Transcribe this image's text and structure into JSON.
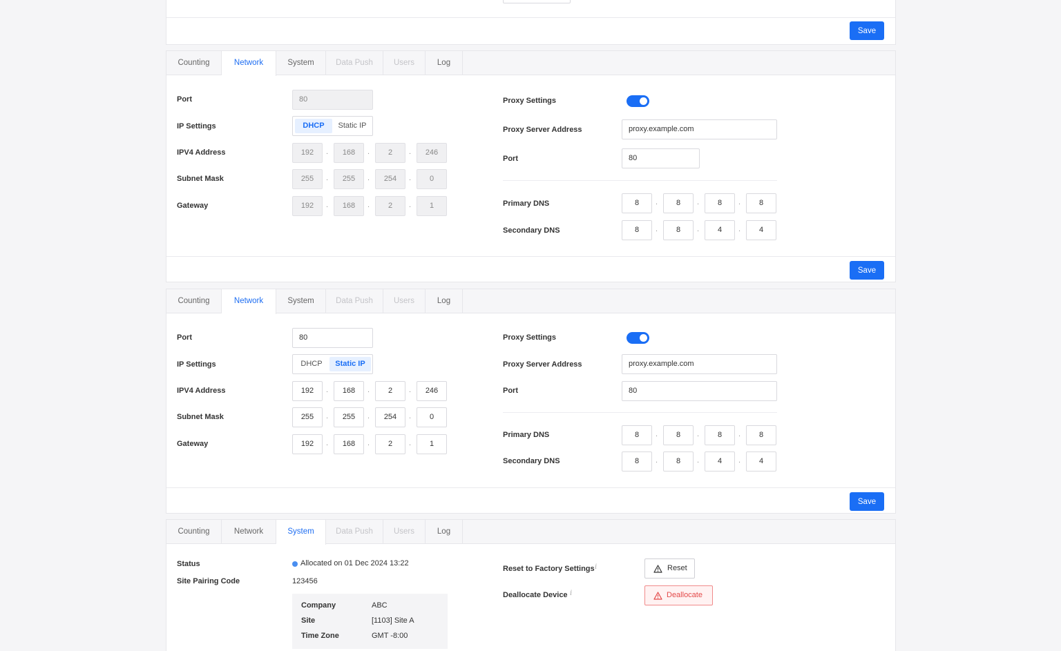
{
  "top": {
    "save_label": "Save"
  },
  "tabs": [
    {
      "label": "Counting"
    },
    {
      "label": "Network"
    },
    {
      "label": "System"
    },
    {
      "label": "Data Push"
    },
    {
      "label": "Users"
    },
    {
      "label": "Log"
    }
  ],
  "panel1": {
    "active_tab": "Network",
    "port_label": "Port",
    "port_value": "80",
    "ip_settings_label": "IP Settings",
    "ip_mode_options": [
      "DHCP",
      "Static IP"
    ],
    "ip_mode_selected": "DHCP",
    "ipv4_label": "IPV4 Address",
    "ipv4": [
      "192",
      "168",
      "2",
      "246"
    ],
    "subnet_label": "Subnet Mask",
    "subnet": [
      "255",
      "255",
      "254",
      "0"
    ],
    "gateway_label": "Gateway",
    "gateway": [
      "192",
      "168",
      "2",
      "1"
    ],
    "proxy_settings_label": "Proxy Settings",
    "proxy_enabled": true,
    "proxy_server_label": "Proxy Server Address",
    "proxy_server_value": "proxy.example.com",
    "proxy_port_label": "Port",
    "proxy_port_value": "80",
    "primary_dns_label": "Primary DNS",
    "primary_dns": [
      "8",
      "8",
      "8",
      "8"
    ],
    "secondary_dns_label": "Secondary DNS",
    "secondary_dns": [
      "8",
      "8",
      "4",
      "4"
    ],
    "save_label": "Save"
  },
  "panel2": {
    "active_tab": "Network",
    "port_label": "Port",
    "port_value": "80",
    "ip_settings_label": "IP Settings",
    "ip_mode_options": [
      "DHCP",
      "Static IP"
    ],
    "ip_mode_selected": "Static IP",
    "ipv4_label": "IPV4 Address",
    "ipv4": [
      "192",
      "168",
      "2",
      "246"
    ],
    "subnet_label": "Subnet Mask",
    "subnet": [
      "255",
      "255",
      "254",
      "0"
    ],
    "gateway_label": "Gateway",
    "gateway": [
      "192",
      "168",
      "2",
      "1"
    ],
    "proxy_settings_label": "Proxy Settings",
    "proxy_enabled": true,
    "proxy_server_label": "Proxy Server Address",
    "proxy_server_value": "proxy.example.com",
    "proxy_port_label": "Port",
    "proxy_port_value": "80",
    "primary_dns_label": "Primary DNS",
    "primary_dns": [
      "8",
      "8",
      "8",
      "8"
    ],
    "secondary_dns_label": "Secondary DNS",
    "secondary_dns": [
      "8",
      "8",
      "4",
      "4"
    ],
    "save_label": "Save"
  },
  "panel3": {
    "active_tab": "System",
    "status_label": "Status",
    "status_value": "Allocated on 01 Dec 2024 13:22",
    "status_color": "#4a8ef0",
    "pairing_label": "Site Pairing Code",
    "pairing_value": "123456",
    "details": [
      {
        "key": "Company",
        "value": "ABC"
      },
      {
        "key": "Site",
        "value": "[1103] Site A"
      },
      {
        "key": "Time Zone",
        "value": "GMT -8:00"
      }
    ],
    "reset_label": "Reset to Factory Settings",
    "reset_button": "Reset",
    "dealloc_label": "Deallocate Device",
    "dealloc_button": "Deallocate",
    "info_glyph": "i"
  },
  "colors": {
    "accent": "#1a6ef5",
    "danger": "#e34848",
    "tab_disabled": "#c4c4c8"
  },
  "icons": {
    "warning": "warning-triangle-icon",
    "info": "info-icon",
    "status": "status-dot-icon"
  }
}
